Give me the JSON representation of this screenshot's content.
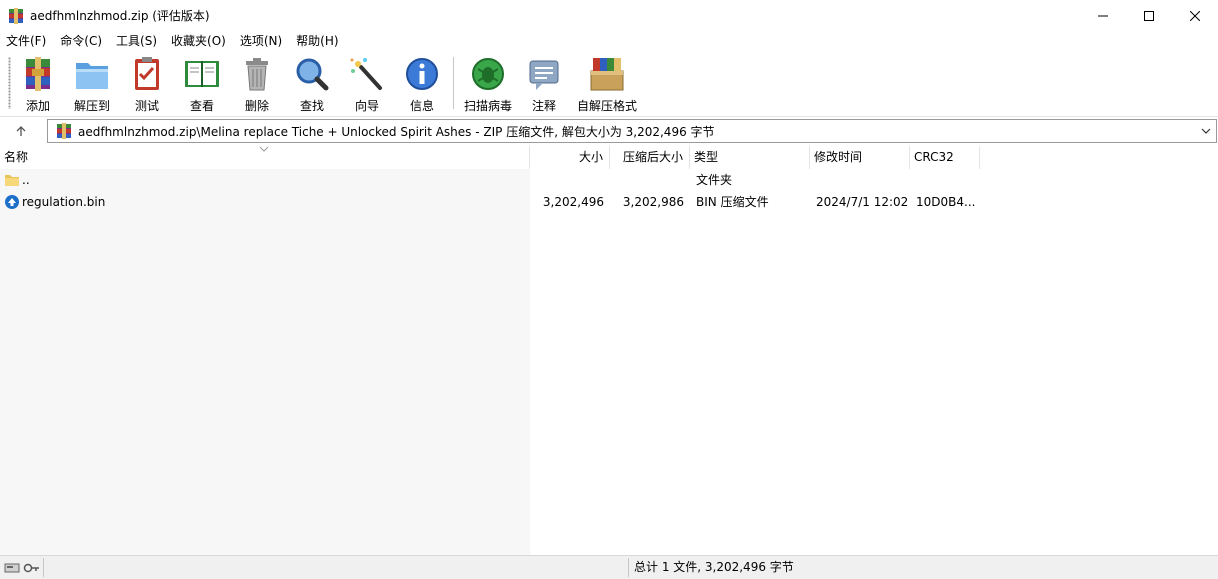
{
  "window": {
    "title": "aedfhmlnzhmod.zip (评估版本)",
    "minimize_icon": "minimize-icon",
    "maximize_icon": "maximize-icon",
    "close_icon": "close-icon"
  },
  "menu": [
    "文件(F)",
    "命令(C)",
    "工具(S)",
    "收藏夹(O)",
    "选项(N)",
    "帮助(H)"
  ],
  "toolbar": {
    "add": "添加",
    "extract_to": "解压到",
    "test": "测试",
    "view": "查看",
    "delete": "删除",
    "find": "查找",
    "wizard": "向导",
    "info": "信息",
    "virus_scan": "扫描病毒",
    "comment": "注释",
    "sfx": "自解压格式"
  },
  "address": {
    "path": "aedfhmlnzhmod.zip\\Melina replace Tiche + Unlocked Spirit Ashes - ZIP 压缩文件, 解包大小为 3,202,496 字节"
  },
  "columns": {
    "name": "名称",
    "size": "大小",
    "packed": "压缩后大小",
    "type": "类型",
    "modified": "修改时间",
    "crc": "CRC32"
  },
  "rows": [
    {
      "name": "..",
      "size": "",
      "packed": "",
      "type": "文件夹",
      "modified": "",
      "crc": "",
      "icon": "folder-icon"
    },
    {
      "name": "regulation.bin",
      "size": "3,202,496",
      "packed": "3,202,986",
      "type": "BIN 压缩文件",
      "modified": "2024/7/1 12:02",
      "crc": "10D0B4...",
      "icon": "bin-file-icon"
    }
  ],
  "status": {
    "summary": "总计 1 文件, 3,202,496 字节"
  },
  "colors": {
    "accent_blue": "#1d6fc9",
    "selection_gray": "#f7f7f7",
    "statusbar": "#f0f0f0"
  }
}
